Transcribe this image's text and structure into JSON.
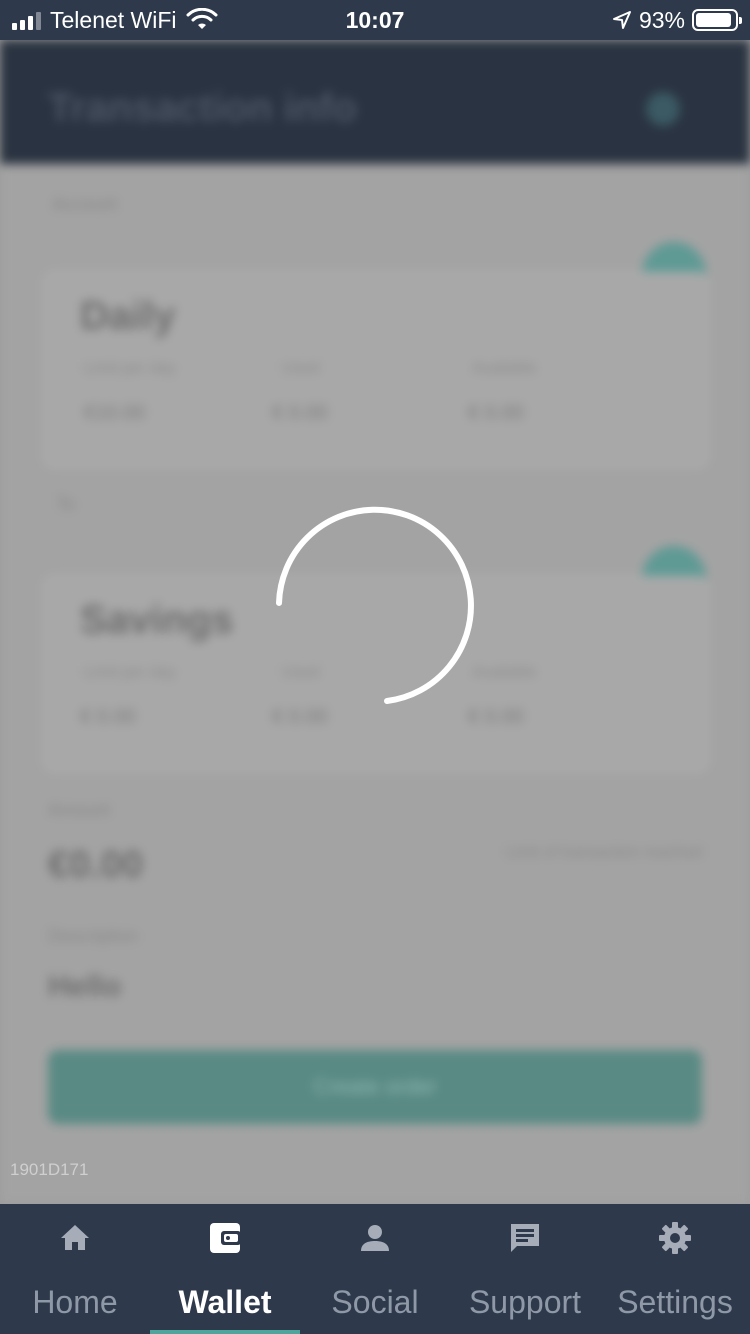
{
  "status_bar": {
    "carrier": "Telenet WiFi",
    "time": "10:07",
    "battery_percent": "93%",
    "battery_level": 0.93,
    "signal_bars": 3
  },
  "background": {
    "title": "Transaction info",
    "section_label_1": "Account",
    "card_1": {
      "title": "Daily",
      "col1_label": "Limit per day",
      "col1_value": "€10.00",
      "col2_label": "Used",
      "col2_value": "€ 0.00",
      "col3_label": "Available",
      "col3_value": "€ 0.00"
    },
    "section_label_2": "To",
    "card_2": {
      "title": "Savings",
      "col1_label": "Limit per day",
      "col1_value": "€ 0.00",
      "col2_label": "Used",
      "col2_value": "€ 0.00",
      "col3_label": "Available",
      "col3_value": "€ 0.00"
    },
    "amount_label": "Amount",
    "amount_value": "€0.00",
    "amount_hint": "Limit of transaction reached",
    "message_label": "Description",
    "message_value": "Hello",
    "create_button": "Create order"
  },
  "build_id": "1901D171",
  "tabs": [
    {
      "label": "Home",
      "icon": "home-icon",
      "active": false
    },
    {
      "label": "Wallet",
      "icon": "wallet-icon",
      "active": true
    },
    {
      "label": "Social",
      "icon": "person-icon",
      "active": false
    },
    {
      "label": "Support",
      "icon": "chat-icon",
      "active": false
    },
    {
      "label": "Settings",
      "icon": "gear-icon",
      "active": false
    }
  ],
  "colors": {
    "nav_background": "#2e3a4b",
    "accent": "#4fa59c",
    "overlay": "#9c9c9c"
  }
}
